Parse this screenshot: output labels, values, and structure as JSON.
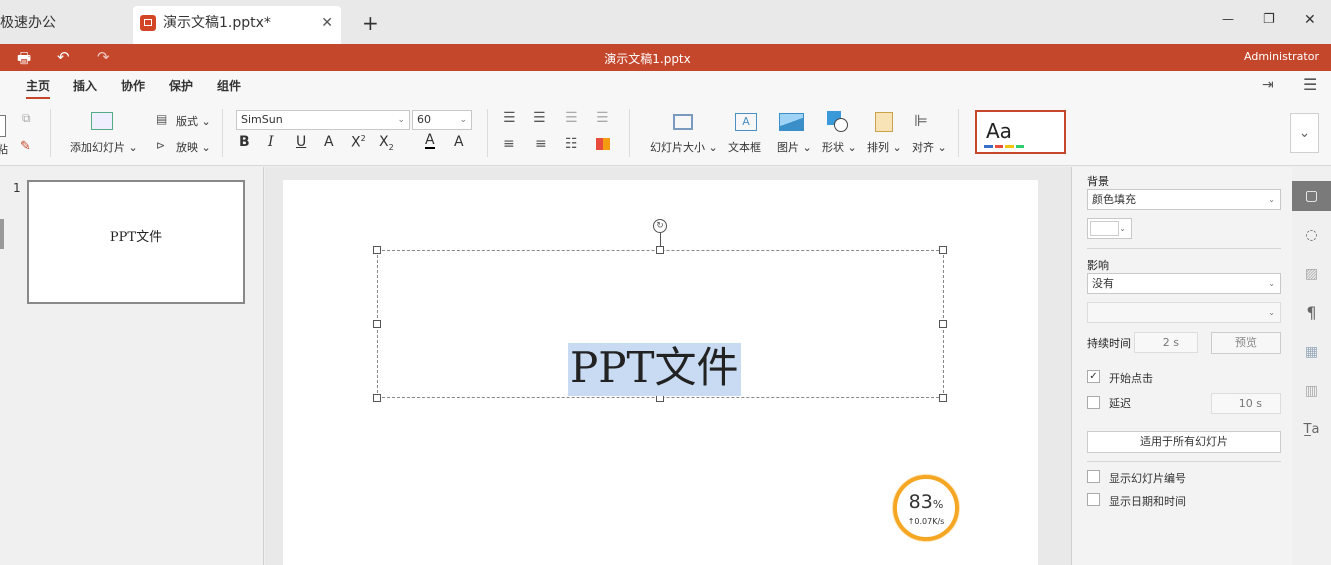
{
  "tabs": [
    {
      "label": "极速办公"
    },
    {
      "label": "演示文稿1.pptx*"
    }
  ],
  "window": {
    "minimize": "—",
    "restore": "❐",
    "close": "✕",
    "newtab": "+",
    "tabclose": "✕"
  },
  "titlebar": {
    "title": "演示文稿1.pptx",
    "user": "Administrator"
  },
  "menu": [
    "主页",
    "插入",
    "协作",
    "保护",
    "组件"
  ],
  "ribbon": {
    "add_slide": "添加幻灯片",
    "layout": "版式",
    "play": "放映",
    "font_name": "SimSun",
    "font_size": "60",
    "slide_size": "幻灯片大小",
    "textbox": "文本框",
    "picture": "图片",
    "shape": "形状",
    "arrange": "排列",
    "align": "对齐",
    "paste_label": "粘",
    "theme_text": "Aa"
  },
  "thumbs": [
    {
      "num": "1",
      "text": "PPT文件"
    }
  ],
  "slide": {
    "title_text": "PPT文件"
  },
  "gauge": {
    "percent": "83",
    "percent_sign": "%",
    "speed": "↑0.07K/s"
  },
  "panel": {
    "background_label": "背景",
    "fill_value": "颜色填充",
    "effect_label": "影响",
    "effect_value": "没有",
    "duration_label": "持续时间",
    "duration_value": "2 s",
    "preview_button": "预览",
    "start_on_click": "开始点击",
    "delay_label": "延迟",
    "delay_value": "10 s",
    "apply_all": "适用于所有幻灯片",
    "show_slide_number": "显示幻灯片编号",
    "show_date_time": "显示日期和时间"
  },
  "colors": {
    "accent": "#c4472c",
    "selection": "#c9dbf2",
    "gauge": "#f5a623"
  }
}
